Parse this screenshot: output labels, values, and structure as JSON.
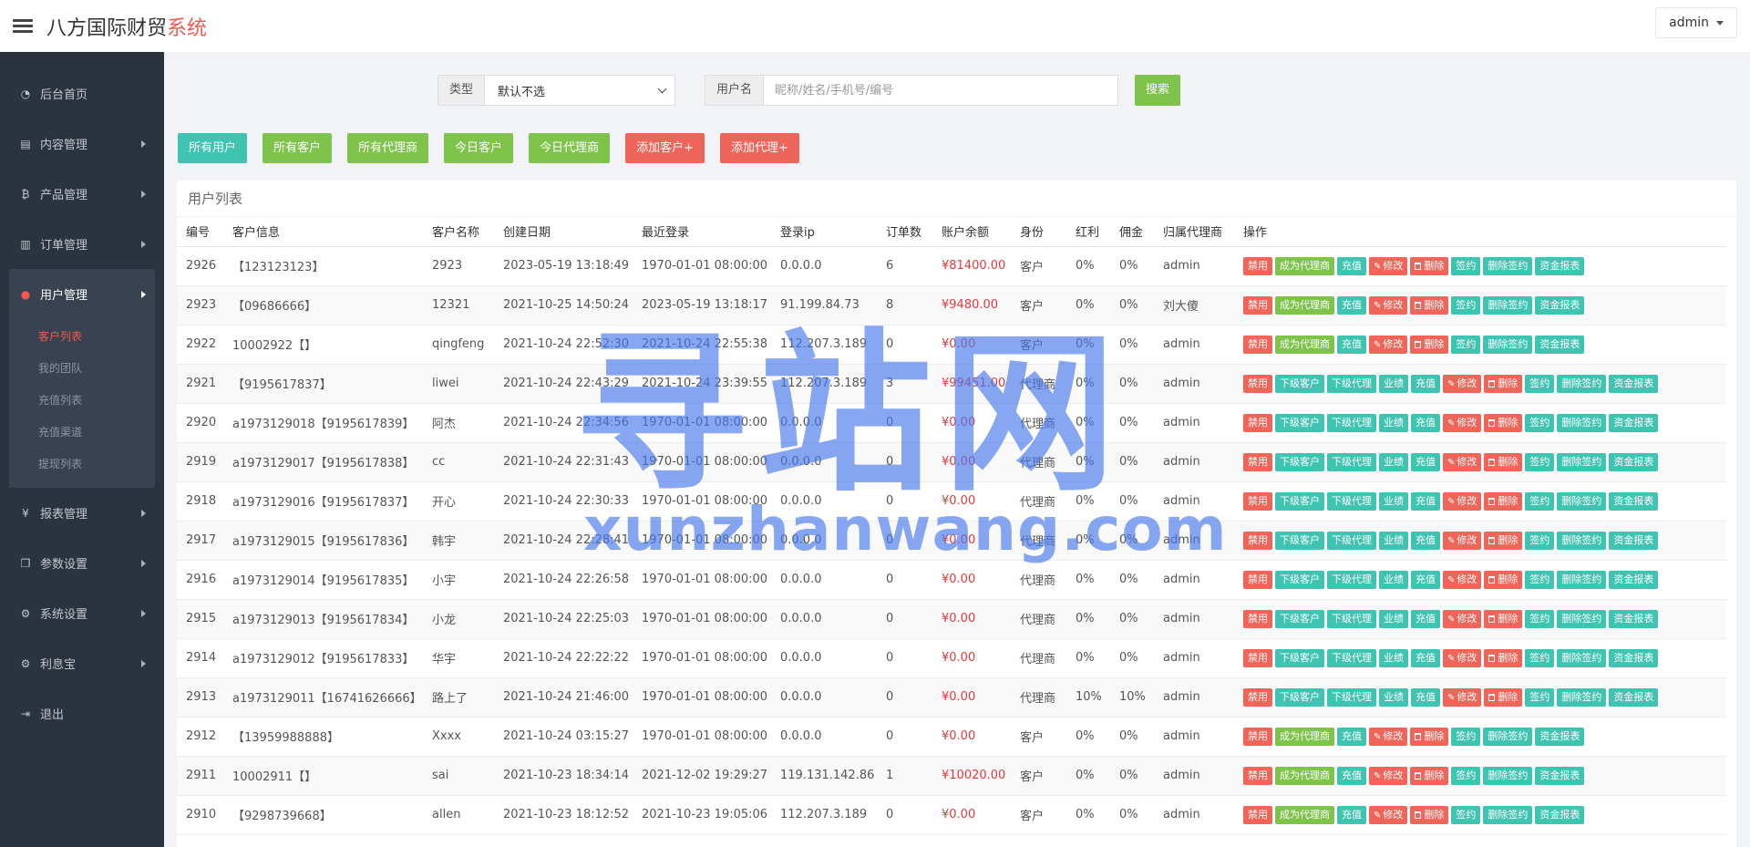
{
  "header": {
    "brand_main": "八方国际财贸",
    "brand_accent": "系统",
    "user_label": "admin"
  },
  "sidebar": {
    "items": [
      {
        "label": "后台首页",
        "icon": "dashboard-icon",
        "arrow": false
      },
      {
        "label": "内容管理",
        "icon": "book-icon",
        "arrow": true
      },
      {
        "label": "产品管理",
        "icon": "bitcoin-icon",
        "arrow": true
      },
      {
        "label": "订单管理",
        "icon": "clipboard-icon",
        "arrow": true
      },
      {
        "label": "用户管理",
        "icon": "user-icon",
        "arrow": true,
        "active": true
      },
      {
        "label": "报表管理",
        "icon": "yen-icon",
        "arrow": true
      },
      {
        "label": "参数设置",
        "icon": "copy-icon",
        "arrow": true
      },
      {
        "label": "系统设置",
        "icon": "cogs-icon",
        "arrow": true
      },
      {
        "label": "利息宝",
        "icon": "cogs-icon",
        "arrow": true
      },
      {
        "label": "退出",
        "icon": "signout-icon",
        "arrow": false
      }
    ],
    "submenu": [
      {
        "label": "客户列表",
        "active": true
      },
      {
        "label": "我的团队"
      },
      {
        "label": "充值列表"
      },
      {
        "label": "充值渠道"
      },
      {
        "label": "提现列表"
      }
    ]
  },
  "filters": {
    "type_label": "类型",
    "type_selected": "默认不选",
    "username_label": "用户名",
    "username_placeholder": "昵称/姓名/手机号/编号",
    "search_label": "搜索"
  },
  "tabs": [
    {
      "label": "所有用户",
      "color": "teal"
    },
    {
      "label": "所有客户",
      "color": "green"
    },
    {
      "label": "所有代理商",
      "color": "green"
    },
    {
      "label": "今日客户",
      "color": "green"
    },
    {
      "label": "今日代理商",
      "color": "green"
    },
    {
      "label": "添加客户+",
      "color": "red"
    },
    {
      "label": "添加代理+",
      "color": "red"
    }
  ],
  "table": {
    "title": "用户列表",
    "columns": [
      "编号",
      "客户信息",
      "客户名称",
      "创建日期",
      "最近登录",
      "登录ip",
      "订单数",
      "账户余额",
      "身份",
      "红利",
      "佣金",
      "归属代理商",
      "操作"
    ],
    "customer_ops": [
      "禁用",
      "成为代理商",
      "充值",
      "修改",
      "删除",
      "签约",
      "删除签约",
      "资金报表"
    ],
    "agent_ops": [
      "禁用",
      "下级客户",
      "下级代理",
      "业绩",
      "充值",
      "修改",
      "删除",
      "签约",
      "删除签约",
      "资金报表"
    ],
    "rows": [
      {
        "id": "2926",
        "info": "【123123123】",
        "name": "2923",
        "created": "2023-05-19 13:18:49",
        "last_login": "1970-01-01 08:00:00",
        "ip": "0.0.0.0",
        "orders": "6",
        "balance": "¥81400.00",
        "role": "客户",
        "bonus": "0%",
        "commission": "0%",
        "agent": "admin",
        "type": "customer"
      },
      {
        "id": "2923",
        "info": "【09686666】",
        "name": "12321",
        "created": "2021-10-25 14:50:24",
        "last_login": "2023-05-19 13:18:17",
        "ip": "91.199.84.73",
        "orders": "8",
        "balance": "¥9480.00",
        "role": "客户",
        "bonus": "0%",
        "commission": "0%",
        "agent": "刘大傻",
        "type": "customer"
      },
      {
        "id": "2922",
        "info": "10002922【】",
        "name": "qingfeng",
        "created": "2021-10-24 22:52:30",
        "last_login": "2021-10-24 22:55:38",
        "ip": "112.207.3.189",
        "orders": "0",
        "balance": "¥0.00",
        "role": "客户",
        "bonus": "0%",
        "commission": "0%",
        "agent": "admin",
        "type": "customer"
      },
      {
        "id": "2921",
        "info": "【9195617837】",
        "name": "liwei",
        "created": "2021-10-24 22:43:29",
        "last_login": "2021-10-24 23:39:55",
        "ip": "112.207.3.189",
        "orders": "3",
        "balance": "¥99451.00",
        "role": "代理商",
        "bonus": "0%",
        "commission": "0%",
        "agent": "admin",
        "type": "agent"
      },
      {
        "id": "2920",
        "info": "a1973129018【9195617839】",
        "name": "阿杰",
        "created": "2021-10-24 22:34:56",
        "last_login": "1970-01-01 08:00:00",
        "ip": "0.0.0.0",
        "orders": "0",
        "balance": "¥0.00",
        "role": "代理商",
        "bonus": "0%",
        "commission": "0%",
        "agent": "admin",
        "type": "agent"
      },
      {
        "id": "2919",
        "info": "a1973129017【9195617838】",
        "name": "cc",
        "created": "2021-10-24 22:31:43",
        "last_login": "1970-01-01 08:00:00",
        "ip": "0.0.0.0",
        "orders": "0",
        "balance": "¥0.00",
        "role": "代理商",
        "bonus": "0%",
        "commission": "0%",
        "agent": "admin",
        "type": "agent"
      },
      {
        "id": "2918",
        "info": "a1973129016【9195617837】",
        "name": "开心",
        "created": "2021-10-24 22:30:33",
        "last_login": "1970-01-01 08:00:00",
        "ip": "0.0.0.0",
        "orders": "0",
        "balance": "¥0.00",
        "role": "代理商",
        "bonus": "0%",
        "commission": "0%",
        "agent": "admin",
        "type": "agent"
      },
      {
        "id": "2917",
        "info": "a1973129015【9195617836】",
        "name": "韩宇",
        "created": "2021-10-24 22:28:41",
        "last_login": "1970-01-01 08:00:00",
        "ip": "0.0.0.0",
        "orders": "0",
        "balance": "¥0.00",
        "role": "代理商",
        "bonus": "0%",
        "commission": "0%",
        "agent": "admin",
        "type": "agent"
      },
      {
        "id": "2916",
        "info": "a1973129014【9195617835】",
        "name": "小宇",
        "created": "2021-10-24 22:26:58",
        "last_login": "1970-01-01 08:00:00",
        "ip": "0.0.0.0",
        "orders": "0",
        "balance": "¥0.00",
        "role": "代理商",
        "bonus": "0%",
        "commission": "0%",
        "agent": "admin",
        "type": "agent"
      },
      {
        "id": "2915",
        "info": "a1973129013【9195617834】",
        "name": "小龙",
        "created": "2021-10-24 22:25:03",
        "last_login": "1970-01-01 08:00:00",
        "ip": "0.0.0.0",
        "orders": "0",
        "balance": "¥0.00",
        "role": "代理商",
        "bonus": "0%",
        "commission": "0%",
        "agent": "admin",
        "type": "agent"
      },
      {
        "id": "2914",
        "info": "a1973129012【9195617833】",
        "name": "华宇",
        "created": "2021-10-24 22:22:22",
        "last_login": "1970-01-01 08:00:00",
        "ip": "0.0.0.0",
        "orders": "0",
        "balance": "¥0.00",
        "role": "代理商",
        "bonus": "0%",
        "commission": "0%",
        "agent": "admin",
        "type": "agent"
      },
      {
        "id": "2913",
        "info": "a1973129011【16741626666】",
        "name": "路上了",
        "created": "2021-10-24 21:46:00",
        "last_login": "1970-01-01 08:00:00",
        "ip": "0.0.0.0",
        "orders": "0",
        "balance": "¥0.00",
        "role": "代理商",
        "bonus": "10%",
        "commission": "10%",
        "agent": "admin",
        "type": "agent"
      },
      {
        "id": "2912",
        "info": "【13959988888】",
        "name": "Xxxx",
        "created": "2021-10-24 03:15:27",
        "last_login": "1970-01-01 08:00:00",
        "ip": "0.0.0.0",
        "orders": "0",
        "balance": "¥0.00",
        "role": "客户",
        "bonus": "0%",
        "commission": "0%",
        "agent": "admin",
        "type": "customer"
      },
      {
        "id": "2911",
        "info": "10002911【】",
        "name": "sai",
        "created": "2021-10-23 18:34:14",
        "last_login": "2021-12-02 19:29:27",
        "ip": "119.131.142.86",
        "orders": "1",
        "balance": "¥10020.00",
        "role": "客户",
        "bonus": "0%",
        "commission": "0%",
        "agent": "admin",
        "type": "customer"
      },
      {
        "id": "2910",
        "info": "【9298739668】",
        "name": "allen",
        "created": "2021-10-23 18:12:52",
        "last_login": "2021-10-23 19:05:06",
        "ip": "112.207.3.189",
        "orders": "0",
        "balance": "¥0.00",
        "role": "客户",
        "bonus": "0%",
        "commission": "0%",
        "agent": "admin",
        "type": "customer"
      }
    ]
  },
  "watermark": {
    "cn": "寻站网",
    "en": "xunzhanwang.com"
  },
  "colors": {
    "accent_red": "#f05a4f",
    "green": "#7ec44b",
    "teal": "#3fc4b2",
    "sidebar_bg": "#2b333e"
  }
}
